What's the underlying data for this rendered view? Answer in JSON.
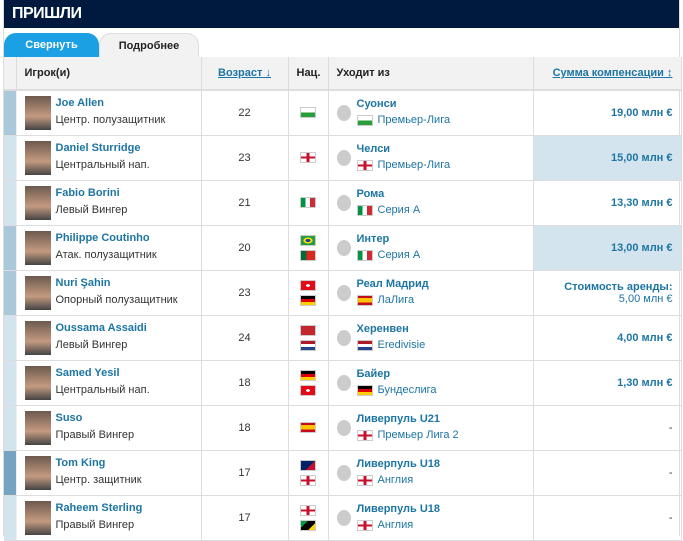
{
  "title": "ПРИШЛИ",
  "tabs": {
    "collapse": "Свернуть",
    "details": "Подробнее"
  },
  "headers": {
    "player": "Игрок(и)",
    "age": "Возраст",
    "age_sort": "↓",
    "nat": "Нац.",
    "from": "Уходит из",
    "fee": "Сумма компенсации",
    "fee_sort": "↕"
  },
  "colors": {
    "header": "#00193f",
    "tab": "#1aa0e3",
    "link": "#1d75a3"
  },
  "rows": [
    {
      "name": "Joe Allen",
      "pos": "Центр. полузащитник",
      "age": "22",
      "flags": [
        "wales"
      ],
      "club": "Суонси",
      "league": "Премьер-Лига",
      "lflag": "wales",
      "fee": "19,00 млн €",
      "strip": "s1",
      "hl": false
    },
    {
      "name": "Daniel Sturridge",
      "pos": "Центральный нап.",
      "age": "23",
      "flags": [
        "england"
      ],
      "club": "Челси",
      "league": "Премьер-Лига",
      "lflag": "england",
      "fee": "15,00 млн €",
      "strip": "s2",
      "hl": true
    },
    {
      "name": "Fabio Borini",
      "pos": "Левый Вингер",
      "age": "21",
      "flags": [
        "italy"
      ],
      "club": "Рома",
      "league": "Серия А",
      "lflag": "italy",
      "fee": "13,30 млн €",
      "strip": "s2",
      "hl": false
    },
    {
      "name": "Philippe Coutinho",
      "pos": "Атак. полузащитник",
      "age": "20",
      "flags": [
        "brazil",
        "portugal"
      ],
      "club": "Интер",
      "league": "Серия А",
      "lflag": "italy",
      "fee": "13,00 млн €",
      "strip": "s1",
      "hl": true
    },
    {
      "name": "Nuri Şahin",
      "pos": "Опорный полузащитник",
      "age": "23",
      "flags": [
        "turkey",
        "germany"
      ],
      "club": "Реал Мадрид",
      "league": "ЛаЛига",
      "lflag": "spain",
      "fee": "Стоимость аренды:",
      "fee_sub": "5,00 млн €",
      "strip": "s1",
      "hl": false
    },
    {
      "name": "Oussama Assaidi",
      "pos": "Левый Вингер",
      "age": "24",
      "flags": [
        "morocco",
        "netherlands"
      ],
      "club": "Херенвен",
      "league": "Eredivisie",
      "lflag": "netherlands",
      "fee": "4,00 млн €",
      "strip": "s2",
      "hl": false
    },
    {
      "name": "Samed Yesil",
      "pos": "Центральный нап.",
      "age": "18",
      "flags": [
        "germany",
        "turkey"
      ],
      "club": "Байер",
      "league": "Бундеслига",
      "lflag": "germany",
      "fee": "1,30 млн €",
      "strip": "s2",
      "hl": false
    },
    {
      "name": "Suso",
      "pos": "Правый Вингер",
      "age": "18",
      "flags": [
        "spain"
      ],
      "club": "Ливерпуль U21",
      "league": "Премьер Лига 2",
      "lflag": "england",
      "fee": "-",
      "strip": "s2",
      "hl": false
    },
    {
      "name": "Tom King",
      "pos": "Центр. защитник",
      "age": "17",
      "flags": [
        "australia",
        "england"
      ],
      "club": "Ливерпуль U18",
      "league": "Англия",
      "lflag": "england",
      "fee": "-",
      "strip": "s3",
      "hl": false
    },
    {
      "name": "Raheem Sterling",
      "pos": "Правый Вингер",
      "age": "17",
      "flags": [
        "england",
        "jamaica"
      ],
      "club": "Ливерпуль U18",
      "league": "Англия",
      "lflag": "england",
      "fee": "-",
      "strip": "s2",
      "hl": false
    }
  ]
}
